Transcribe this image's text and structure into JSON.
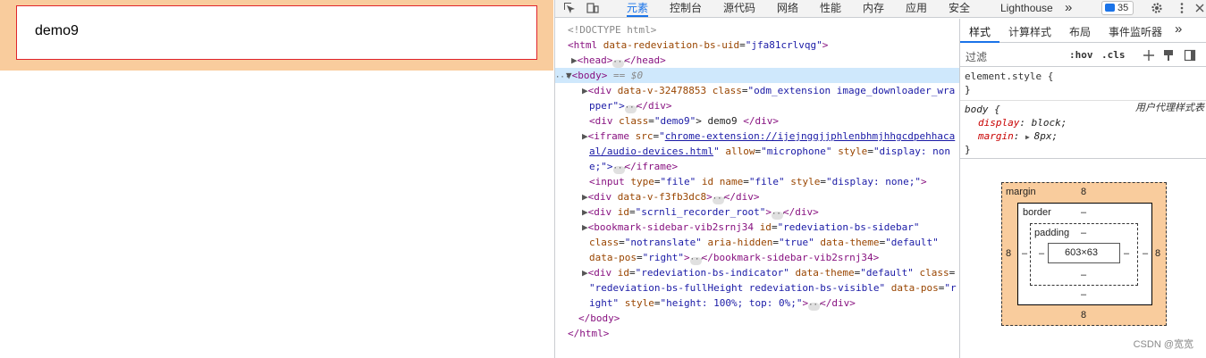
{
  "preview": {
    "demo_text": "demo9"
  },
  "devtools": {
    "tabs": [
      "元素",
      "控制台",
      "源代码",
      "网络",
      "性能",
      "内存",
      "应用",
      "安全",
      "Lighthouse"
    ],
    "more": "»",
    "message_count": "35",
    "elements": {
      "doctype": "<!DOCTYPE html>",
      "html_open_tag": "<html",
      "html_attr": "data-redeviation-bs-uid",
      "html_val": "\"jfa81crlvqg\"",
      "head_open": "<head>",
      "head_close": "</head>",
      "body_open": "<body>",
      "body_eq": "== $0",
      "l1_tag": "<div",
      "l1_attr1": "data-v-32478853",
      "l1_attr2": "class",
      "l1_val2": "\"odm_extension image_downloader_wra",
      "l1_cont": "pper\">",
      "l1_close": "</div>",
      "l2_tag": "<div",
      "l2_attr": "class",
      "l2_val": "\"demo9\"",
      "l2_text": "> demo9 ",
      "l2_close": "</div>",
      "l3_tag": "<iframe",
      "l3_attr1": "src",
      "l3_link1": "chrome-extension://ijejnggjjphlenbhmjhhgcdpehhaca",
      "l3_link2": "al/audio-devices.html",
      "l3_attr2": "allow",
      "l3_val2": "\"microphone\"",
      "l3_attr3": "style",
      "l3_val3": "\"display: non",
      "l3_cont": "e;\">",
      "l3_close": "</iframe>",
      "l4_tag": "<input",
      "l4_a1": "type",
      "l4_v1": "\"file\"",
      "l4_a2": "id",
      "l4_a3": "name",
      "l4_v3": "\"file\"",
      "l4_a4": "style",
      "l4_v4": "\"display: none;\"",
      "l5_tag": "<div",
      "l5_attr": "data-v-f3fb3dc8",
      "l5_close": "</div>",
      "l6_tag": "<div",
      "l6_attr": "id",
      "l6_val": "\"scrnli_recorder_root\"",
      "l6_close": "</div>",
      "l7_tag": "<bookmark-sidebar-vib2srnj34",
      "l7_a1": "id",
      "l7_v1": "\"redeviation-bs-sidebar\"",
      "l7_a2": "class",
      "l7_v2": "\"notranslate\"",
      "l7_a3": "aria-hidden",
      "l7_v3": "\"true\"",
      "l7_a4": "data-theme",
      "l7_v4": "\"default\"",
      "l7_a5": "data-pos",
      "l7_v5": "\"right\"",
      "l7_close": "</bookmark-sidebar-vib2srnj34>",
      "l8_tag": "<div",
      "l8_a1": "id",
      "l8_v1": "\"redeviation-bs-indicator\"",
      "l8_a2": "data-theme",
      "l8_v2": "\"default\"",
      "l8_a3": "class",
      "l8_v3a": "\"redeviation-bs-fullHeight redeviation-bs-visible\"",
      "l8_a4": "data-pos",
      "l8_v4a": "\"r",
      "l8_v4b": "ight\"",
      "l8_a5": "style",
      "l8_v5": "\"height: 100%; top: 0%;\"",
      "l8_close": "</div>",
      "body_close": "</body>",
      "html_close": "</html>"
    },
    "styles": {
      "sub_tabs": [
        "样式",
        "计算样式",
        "布局",
        "事件监听器"
      ],
      "sub_more": "»",
      "filter_placeholder": "过滤",
      "hov": ":hov",
      "cls": ".cls",
      "element_style_selector": "element.style {",
      "close_brace": "}",
      "body_selector": "body {",
      "ua_label": "用户代理样式表",
      "prop1": "display",
      "val1": "block;",
      "prop2": "margin",
      "val2": "8px;"
    },
    "box_model": {
      "margin_label": "margin",
      "margin_top": "8",
      "margin_bottom": "8",
      "margin_left": "8",
      "margin_right": "8",
      "border_label": "border",
      "border_top": "–",
      "border_bottom": "–",
      "border_left": "–",
      "border_right": "–",
      "padding_label": "padding",
      "padding_top": "–",
      "padding_bottom": "–",
      "padding_left": "–",
      "padding_right": "–",
      "content": "603×63"
    },
    "watermark": "CSDN @宽宽"
  }
}
